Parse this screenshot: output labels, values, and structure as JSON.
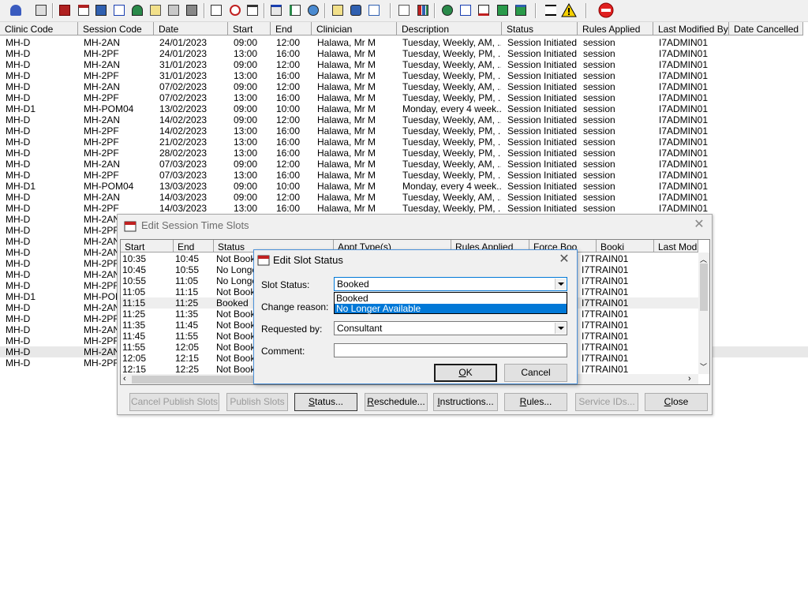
{
  "main_table": {
    "columns": [
      "Clinic Code",
      "Session Code",
      "Date",
      "Start",
      "End",
      "Clinician",
      "Description",
      "Status",
      "Rules Applied",
      "Last Modified By",
      "Date Cancelled"
    ],
    "rows": [
      [
        "MH-D",
        "MH-2AN",
        "24/01/2023",
        "09:00",
        "12:00",
        "Halawa, Mr M",
        "Tuesday, Weekly, AM, ...",
        "Session Initiated",
        "session",
        "I7ADMIN01",
        ""
      ],
      [
        "MH-D",
        "MH-2PF",
        "24/01/2023",
        "13:00",
        "16:00",
        "Halawa, Mr M",
        "Tuesday, Weekly, PM, ...",
        "Session Initiated",
        "session",
        "I7ADMIN01",
        ""
      ],
      [
        "MH-D",
        "MH-2AN",
        "31/01/2023",
        "09:00",
        "12:00",
        "Halawa, Mr M",
        "Tuesday, Weekly, AM, ...",
        "Session Initiated",
        "session",
        "I7ADMIN01",
        ""
      ],
      [
        "MH-D",
        "MH-2PF",
        "31/01/2023",
        "13:00",
        "16:00",
        "Halawa, Mr M",
        "Tuesday, Weekly, PM, ...",
        "Session Initiated",
        "session",
        "I7ADMIN01",
        ""
      ],
      [
        "MH-D",
        "MH-2AN",
        "07/02/2023",
        "09:00",
        "12:00",
        "Halawa, Mr M",
        "Tuesday, Weekly, AM, ...",
        "Session Initiated",
        "session",
        "I7ADMIN01",
        ""
      ],
      [
        "MH-D",
        "MH-2PF",
        "07/02/2023",
        "13:00",
        "16:00",
        "Halawa, Mr M",
        "Tuesday, Weekly, PM, ...",
        "Session Initiated",
        "session",
        "I7ADMIN01",
        ""
      ],
      [
        "MH-D1",
        "MH-POM04",
        "13/02/2023",
        "09:00",
        "10:00",
        "Halawa, Mr M",
        "Monday, every 4 week...",
        "Session Initiated",
        "session",
        "I7ADMIN01",
        ""
      ],
      [
        "MH-D",
        "MH-2AN",
        "14/02/2023",
        "09:00",
        "12:00",
        "Halawa, Mr M",
        "Tuesday, Weekly, AM, ...",
        "Session Initiated",
        "session",
        "I7ADMIN01",
        ""
      ],
      [
        "MH-D",
        "MH-2PF",
        "14/02/2023",
        "13:00",
        "16:00",
        "Halawa, Mr M",
        "Tuesday, Weekly, PM, ...",
        "Session Initiated",
        "session",
        "I7ADMIN01",
        ""
      ],
      [
        "MH-D",
        "MH-2PF",
        "21/02/2023",
        "13:00",
        "16:00",
        "Halawa, Mr M",
        "Tuesday, Weekly, PM, ...",
        "Session Initiated",
        "session",
        "I7ADMIN01",
        ""
      ],
      [
        "MH-D",
        "MH-2PF",
        "28/02/2023",
        "13:00",
        "16:00",
        "Halawa, Mr M",
        "Tuesday, Weekly, PM, ...",
        "Session Initiated",
        "session",
        "I7ADMIN01",
        ""
      ],
      [
        "MH-D",
        "MH-2AN",
        "07/03/2023",
        "09:00",
        "12:00",
        "Halawa, Mr M",
        "Tuesday, Weekly, AM, ...",
        "Session Initiated",
        "session",
        "I7ADMIN01",
        ""
      ],
      [
        "MH-D",
        "MH-2PF",
        "07/03/2023",
        "13:00",
        "16:00",
        "Halawa, Mr M",
        "Tuesday, Weekly, PM, ...",
        "Session Initiated",
        "session",
        "I7ADMIN01",
        ""
      ],
      [
        "MH-D1",
        "MH-POM04",
        "13/03/2023",
        "09:00",
        "10:00",
        "Halawa, Mr M",
        "Monday, every 4 week...",
        "Session Initiated",
        "session",
        "I7ADMIN01",
        ""
      ],
      [
        "MH-D",
        "MH-2AN",
        "14/03/2023",
        "09:00",
        "12:00",
        "Halawa, Mr M",
        "Tuesday, Weekly, AM, ...",
        "Session Initiated",
        "session",
        "I7ADMIN01",
        ""
      ],
      [
        "MH-D",
        "MH-2PF",
        "14/03/2023",
        "13:00",
        "16:00",
        "Halawa, Mr M",
        "Tuesday, Weekly, PM, ...",
        "Session Initiated",
        "session",
        "I7ADMIN01",
        ""
      ],
      [
        "MH-D",
        "MH-2AN",
        "",
        "",
        "",
        "",
        "",
        "",
        "",
        "",
        ""
      ],
      [
        "MH-D",
        "MH-2PF",
        "",
        "",
        "",
        "",
        "",
        "",
        "",
        "",
        ""
      ],
      [
        "MH-D",
        "MH-2AN",
        "",
        "",
        "",
        "",
        "",
        "",
        "",
        "",
        ""
      ],
      [
        "MH-D",
        "MH-2AN",
        "",
        "",
        "",
        "",
        "",
        "",
        "",
        "",
        ""
      ],
      [
        "MH-D",
        "MH-2PF",
        "",
        "",
        "",
        "",
        "",
        "",
        "",
        "",
        ""
      ],
      [
        "MH-D",
        "MH-2AN",
        "",
        "",
        "",
        "",
        "",
        "",
        "",
        "",
        ""
      ],
      [
        "MH-D",
        "MH-2PF",
        "",
        "",
        "",
        "",
        "",
        "",
        "",
        "",
        ""
      ],
      [
        "MH-D1",
        "MH-POM",
        "",
        "",
        "",
        "",
        "",
        "",
        "",
        "",
        ""
      ],
      [
        "MH-D",
        "MH-2AN",
        "",
        "",
        "",
        "",
        "",
        "",
        "",
        "",
        ""
      ],
      [
        "MH-D",
        "MH-2PF",
        "",
        "",
        "",
        "",
        "",
        "",
        "",
        "",
        ""
      ],
      [
        "MH-D",
        "MH-2AN",
        "",
        "",
        "",
        "",
        "",
        "",
        "",
        "",
        ""
      ],
      [
        "MH-D",
        "MH-2PF",
        "",
        "",
        "",
        "",
        "",
        "",
        "",
        "",
        ""
      ],
      [
        "MH-D",
        "MH-2AN",
        "",
        "",
        "",
        "",
        "",
        "",
        "",
        "",
        ""
      ],
      [
        "MH-D",
        "MH-2PF",
        "",
        "",
        "",
        "",
        "",
        "",
        "",
        "",
        ""
      ]
    ],
    "selected_row": 28
  },
  "session_dialog": {
    "title": "Edit Session Time Slots",
    "columns": [
      "Start",
      "End",
      "Status",
      "Appt Type(s)",
      "Rules Applied",
      "Force Boo",
      "Booki",
      "Last Modified By"
    ],
    "rows": [
      [
        "10:35",
        "10:45",
        "Not Book",
        "I7TRAIN01"
      ],
      [
        "10:45",
        "10:55",
        "No Longe",
        "I7TRAIN01"
      ],
      [
        "10:55",
        "11:05",
        "No Longe",
        "I7TRAIN01"
      ],
      [
        "11:05",
        "11:15",
        "Not Book",
        "I7TRAIN01"
      ],
      [
        "11:15",
        "11:25",
        "Booked",
        "I7TRAIN01"
      ],
      [
        "11:25",
        "11:35",
        "Not Book",
        "I7TRAIN01"
      ],
      [
        "11:35",
        "11:45",
        "Not Book",
        "I7TRAIN01"
      ],
      [
        "11:45",
        "11:55",
        "Not Book",
        "I7TRAIN01"
      ],
      [
        "11:55",
        "12:05",
        "Not Book",
        "I7TRAIN01"
      ],
      [
        "12:05",
        "12:15",
        "Not Book",
        "I7TRAIN01"
      ],
      [
        "12:15",
        "12:25",
        "Not Book",
        "I7TRAIN01"
      ]
    ],
    "selected_row": 4,
    "buttons": {
      "cancel_publish": "Cancel Publish Slots",
      "publish": "Publish Slots",
      "status_u": "S",
      "status_rest": "tatus...",
      "reschedule_u": "R",
      "reschedule_rest": "eschedule...",
      "instructions_u": "I",
      "instructions_rest": "nstructions...",
      "rules_u": "R",
      "rules_rest": "ules...",
      "service_ids": "Service IDs...",
      "close_u": "C",
      "close_rest": "lose"
    }
  },
  "status_dialog": {
    "title": "Edit Slot Status",
    "slot_status_label": "Slot Status:",
    "slot_status_value": "Booked",
    "change_reason_label": "Change reason:",
    "requested_by_label": "Requested by:",
    "requested_by_value": "Consultant",
    "comment_label": "Comment:",
    "comment_value": "",
    "dropdown_options": [
      "Booked",
      "No Longer Available"
    ],
    "highlighted_option": 1,
    "ok_u": "O",
    "ok_rest": "K",
    "cancel": "Cancel"
  },
  "colors": {
    "selection": "#0078d7",
    "exit_icon": "#e02020",
    "warning_icon": "#f5d000"
  }
}
